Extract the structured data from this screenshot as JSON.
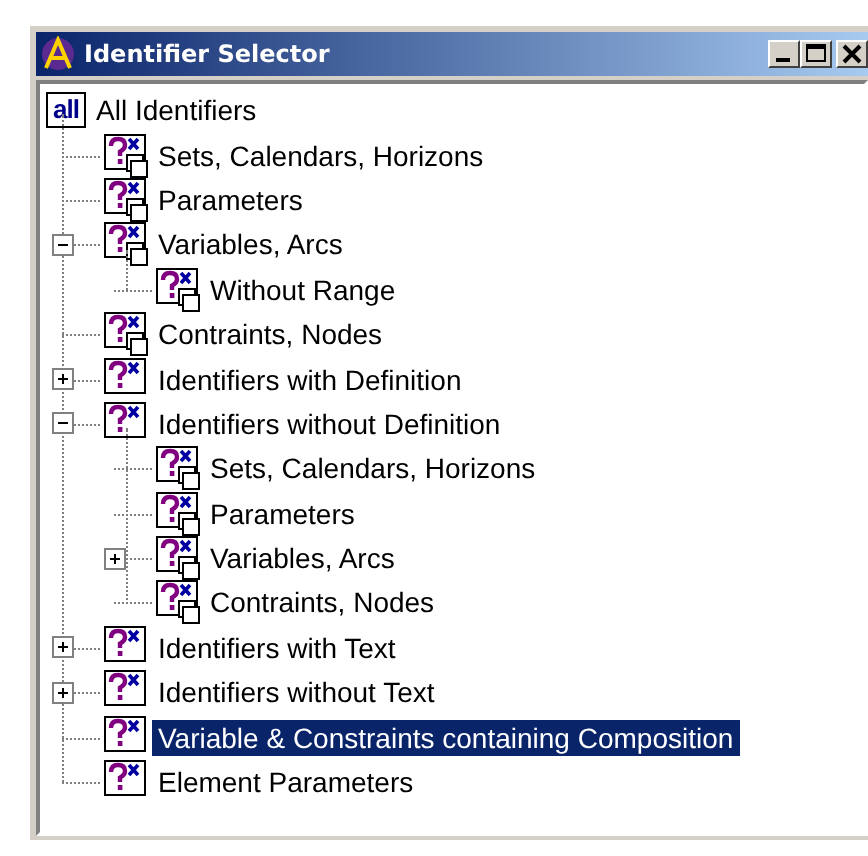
{
  "window": {
    "title": "Identifier Selector"
  },
  "tree": {
    "label": "All Identifiers",
    "icon_text": "all",
    "kind": "root",
    "selected": false,
    "children": [
      {
        "label": "Sets, Calendars, Horizons",
        "kind": "typed",
        "selected": false
      },
      {
        "label": "Parameters",
        "kind": "typed",
        "selected": false
      },
      {
        "label": "Variables, Arcs",
        "kind": "typed",
        "selected": false,
        "expanded": true,
        "children": [
          {
            "label": "Without Range",
            "kind": "typed",
            "selected": false
          }
        ]
      },
      {
        "label": "Contraints, Nodes",
        "kind": "typed",
        "selected": false
      },
      {
        "label": "Identifiers with Definition",
        "kind": "plain",
        "selected": false,
        "expanded": false
      },
      {
        "label": "Identifiers without Definition",
        "kind": "plain",
        "selected": false,
        "expanded": true,
        "children": [
          {
            "label": "Sets, Calendars, Horizons",
            "kind": "typed",
            "selected": false
          },
          {
            "label": "Parameters",
            "kind": "typed",
            "selected": false
          },
          {
            "label": "Variables, Arcs",
            "kind": "typed",
            "selected": false,
            "expanded": false
          },
          {
            "label": "Contraints, Nodes",
            "kind": "typed",
            "selected": false
          }
        ]
      },
      {
        "label": "Identifiers with Text",
        "kind": "plain",
        "selected": false,
        "expanded": false
      },
      {
        "label": "Identifiers without Text",
        "kind": "plain",
        "selected": false,
        "expanded": false
      },
      {
        "label": "Variable & Constraints containing Composition",
        "kind": "plain",
        "selected": true
      },
      {
        "label": "Element Parameters",
        "kind": "plain",
        "selected": false
      }
    ]
  }
}
